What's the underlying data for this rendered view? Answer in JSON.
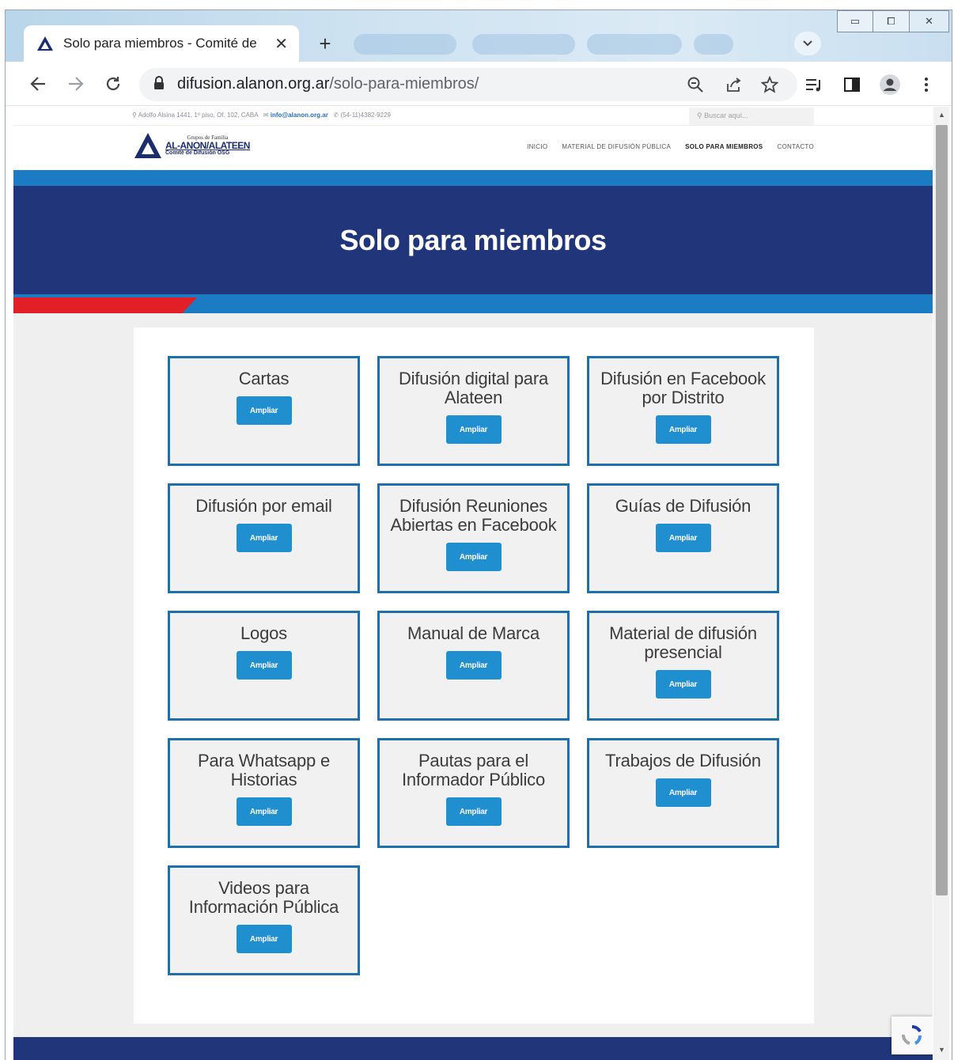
{
  "browser": {
    "tab_title": "Solo para miembros - Comité de",
    "tab_close": "✕",
    "new_tab": "+",
    "url_host": "difusion.alanon.org.ar",
    "url_path": "/solo-para-miembros/",
    "window_controls": {
      "minimize": "▭",
      "maximize": "⧠",
      "close": "✕"
    }
  },
  "site": {
    "topbar": {
      "address": "⚲ Adolfo Alsina 1441, 1º piso, Of. 102, CABA",
      "email": "info@alanon.org.ar",
      "phone": "(54-11)4382-9229",
      "search_placeholder": "Buscar aquí..."
    },
    "logo": {
      "sup": "Grupos de Familia",
      "main": "AL-ANON/ALATEEN",
      "sub": "Comité de Difusión OSG"
    },
    "menu": [
      {
        "label": "INICIO"
      },
      {
        "label": "MATERIAL DE DIFUSIÓN PÚBLICA"
      },
      {
        "label": "SOLO PARA MIEMBROS"
      },
      {
        "label": "CONTACTO"
      }
    ],
    "hero_title": "Solo para miembros",
    "items": [
      {
        "title": "Cartas",
        "button": "Ampliar"
      },
      {
        "title": "Difusión digital para Alateen",
        "button": "Ampliar"
      },
      {
        "title": "Difusión en Facebook por Distrito",
        "button": "Ampliar"
      },
      {
        "title": "Difusión por email",
        "button": "Ampliar"
      },
      {
        "title": "Difusión Reuniones Abiertas en Facebook",
        "button": "Ampliar"
      },
      {
        "title": "Guías de Difusión",
        "button": "Ampliar"
      },
      {
        "title": "Logos",
        "button": "Ampliar"
      },
      {
        "title": "Manual de Marca",
        "button": "Ampliar"
      },
      {
        "title": "Material de difusión presencial",
        "button": "Ampliar"
      },
      {
        "title": "Para Whatsapp e Historias",
        "button": "Ampliar"
      },
      {
        "title": "Pautas para el Informador Público",
        "button": "Ampliar"
      },
      {
        "title": "Trabajos de Difusión",
        "button": "Ampliar"
      },
      {
        "title": "Videos para Información Pública",
        "button": "Ampliar"
      }
    ]
  },
  "colors": {
    "navy": "#20357a",
    "blue_band": "#1b7cc3",
    "red_accent": "#e21f26",
    "item_border": "#1f6fa8",
    "button": "#1f8fcf"
  }
}
